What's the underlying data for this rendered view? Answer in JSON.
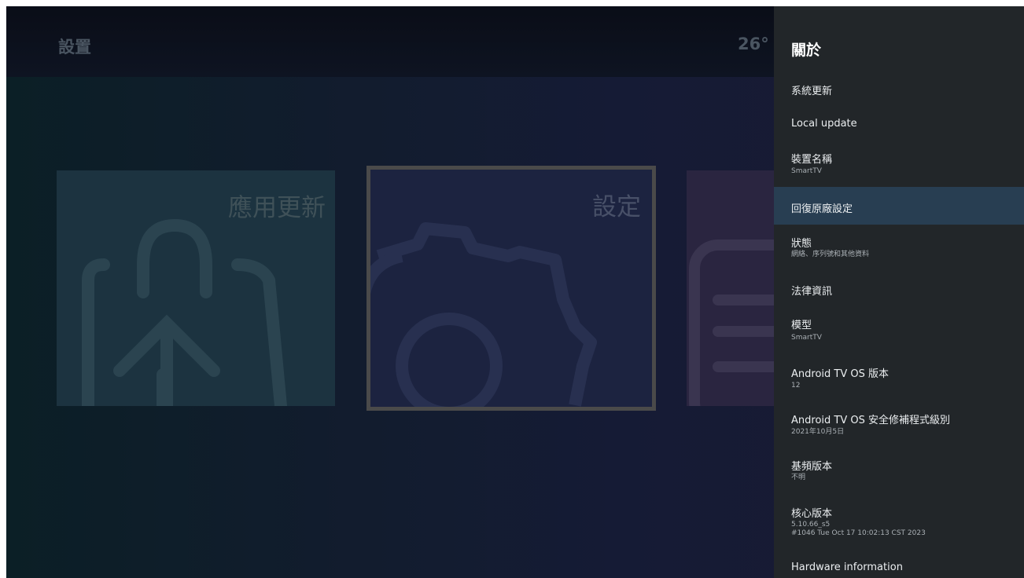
{
  "background": {
    "title": "設置",
    "clock": "26°",
    "cards": [
      {
        "title": "應用更新",
        "icon": "app-update-icon"
      },
      {
        "title": "設定",
        "icon": "gear-icon"
      },
      {
        "title": "",
        "icon": "document-icon"
      }
    ]
  },
  "panel": {
    "title": "關於",
    "items": [
      {
        "label": "系統更新",
        "sub": ""
      },
      {
        "label": "Local update",
        "sub": ""
      },
      {
        "label": "裝置名稱",
        "sub": "SmartTV"
      },
      {
        "label": "回復原廠設定",
        "sub": "",
        "focused": true
      },
      {
        "label": "狀態",
        "sub": "網絡、序列號和其他資料"
      },
      {
        "label": "法律資訊",
        "sub": ""
      },
      {
        "label": "模型",
        "sub": "SmartTV"
      },
      {
        "label": "Android TV OS 版本",
        "sub": "12"
      },
      {
        "label": "Android TV OS 安全修補程式級別",
        "sub": "2021年10月5日"
      },
      {
        "label": "基頻版本",
        "sub": "不明"
      },
      {
        "label": "核心版本",
        "sub": "5.10.66_s5",
        "sub2": "#1046 Tue Oct 17 10:02:13 CST 2023"
      },
      {
        "label": "Hardware information",
        "sub": ""
      }
    ]
  },
  "colors": {
    "panel_bg": "#222629",
    "focus_bg": "#283e52",
    "text": "#eceff1"
  }
}
